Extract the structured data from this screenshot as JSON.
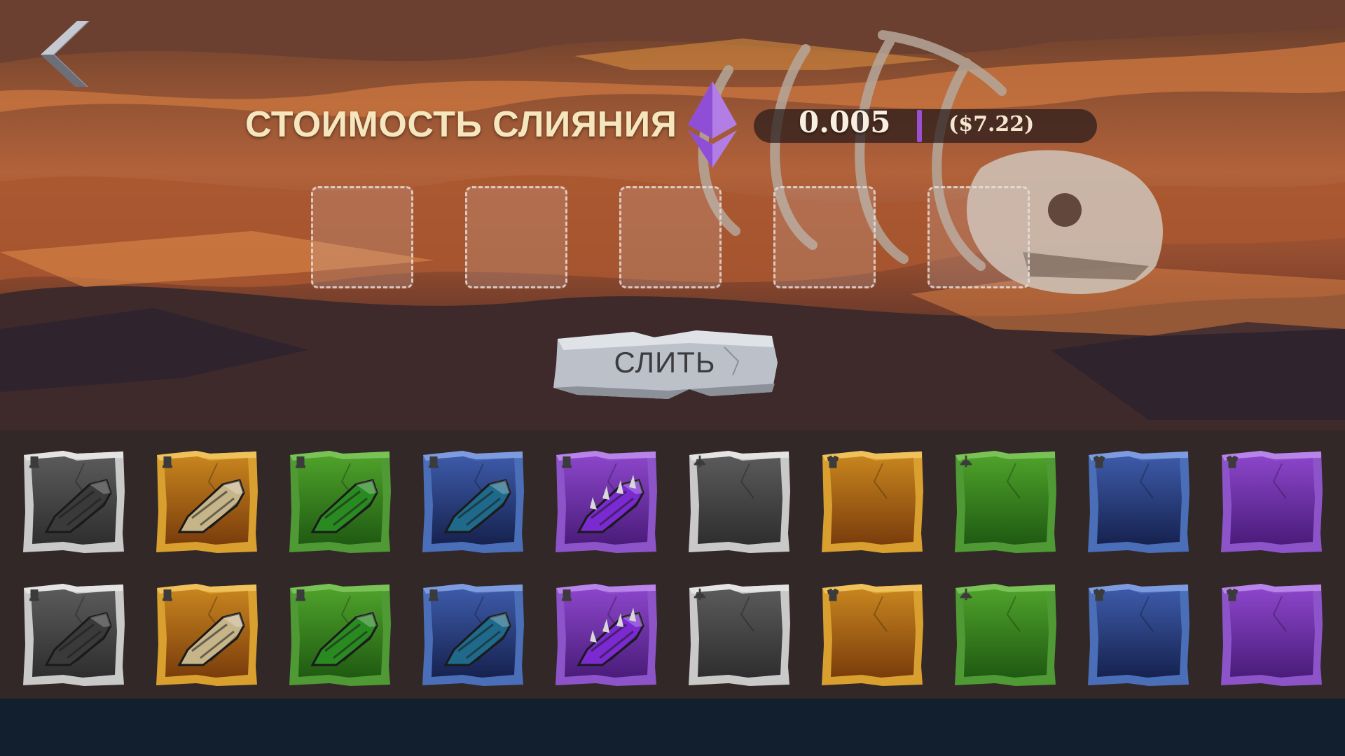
{
  "title": "СТОИМОСТЬ СЛИЯНИЯ",
  "price": {
    "eth": "0.005",
    "usd": "($7.22)"
  },
  "icons": {
    "back": "chevron-left-icon",
    "currency": "ethereum-icon"
  },
  "merge_button": {
    "label": "СЛИТЬ"
  },
  "merge_slots": [
    {},
    {},
    {},
    {},
    {}
  ],
  "colors": {
    "common": "#c9c9c9",
    "rare": "#d9a030",
    "uncommon": "#4f9a35",
    "epic_blue": "#4a6fb8",
    "legendary": "#8d54c9",
    "accent_divider": "#9b4fd1"
  },
  "inventory": {
    "rows": [
      [
        {
          "rarity": "gray",
          "slot": "glove-icon",
          "item": "gauntlet"
        },
        {
          "rarity": "gold",
          "slot": "glove-icon",
          "item": "gauntlet"
        },
        {
          "rarity": "green",
          "slot": "glove-icon",
          "item": "gauntlet"
        },
        {
          "rarity": "blue",
          "slot": "glove-icon",
          "item": "gauntlet"
        },
        {
          "rarity": "purple",
          "slot": "glove-icon",
          "item": "gauntlet"
        },
        {
          "rarity": "gray",
          "slot": "helmet-icon",
          "item": "empty"
        },
        {
          "rarity": "gold",
          "slot": "armor-icon",
          "item": "empty"
        },
        {
          "rarity": "green",
          "slot": "helmet-icon",
          "item": "empty"
        },
        {
          "rarity": "blue",
          "slot": "armor-icon",
          "item": "empty"
        },
        {
          "rarity": "purple",
          "slot": "armor-icon",
          "item": "empty"
        }
      ],
      [
        {
          "rarity": "gray",
          "slot": "glove-icon",
          "item": "gauntlet"
        },
        {
          "rarity": "gold",
          "slot": "glove-icon",
          "item": "gauntlet"
        },
        {
          "rarity": "green",
          "slot": "glove-icon",
          "item": "gauntlet"
        },
        {
          "rarity": "blue",
          "slot": "glove-icon",
          "item": "gauntlet"
        },
        {
          "rarity": "purple",
          "slot": "glove-icon",
          "item": "gauntlet"
        },
        {
          "rarity": "gray",
          "slot": "helmet-icon",
          "item": "empty"
        },
        {
          "rarity": "gold",
          "slot": "armor-icon",
          "item": "empty"
        },
        {
          "rarity": "green",
          "slot": "helmet-icon",
          "item": "empty"
        },
        {
          "rarity": "blue",
          "slot": "armor-icon",
          "item": "empty"
        },
        {
          "rarity": "purple",
          "slot": "armor-icon",
          "item": "empty"
        }
      ]
    ]
  }
}
